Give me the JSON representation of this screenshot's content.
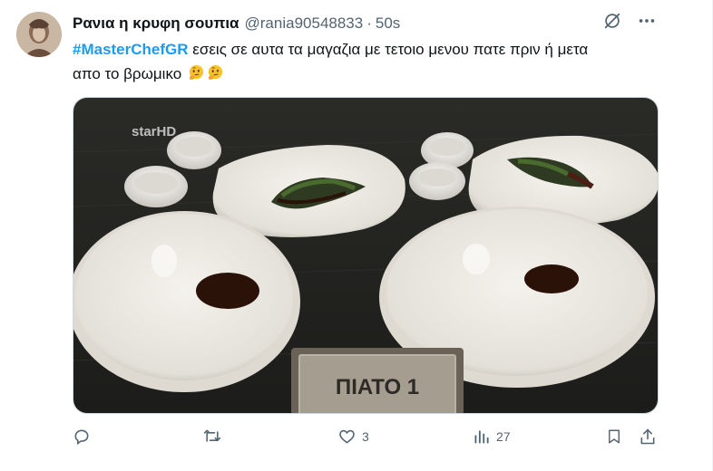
{
  "tweet": {
    "display_name": "Ρανια η κρυφη σουπια",
    "handle": "@rania90548833",
    "separator": "·",
    "time": "50s",
    "hashtag": "#MasterChefGR",
    "body_line1": " εσεις σε αυτα τα μαγαζια με τετοιο μενου  πατε πριν ή μετα",
    "body_line2": "απο το βρωμικο",
    "emoji": [
      "thinking-face",
      "thinking-face"
    ]
  },
  "media": {
    "watermark": "starHD",
    "plate_sign": "ΠΙΑΤΟ 1"
  },
  "actions": {
    "reply_count": "",
    "retweet_count": "",
    "like_count": "3",
    "views_count": "27"
  },
  "colors": {
    "link": "#1d9bf0",
    "secondary_text": "#536471",
    "primary_text": "#0f1419"
  }
}
